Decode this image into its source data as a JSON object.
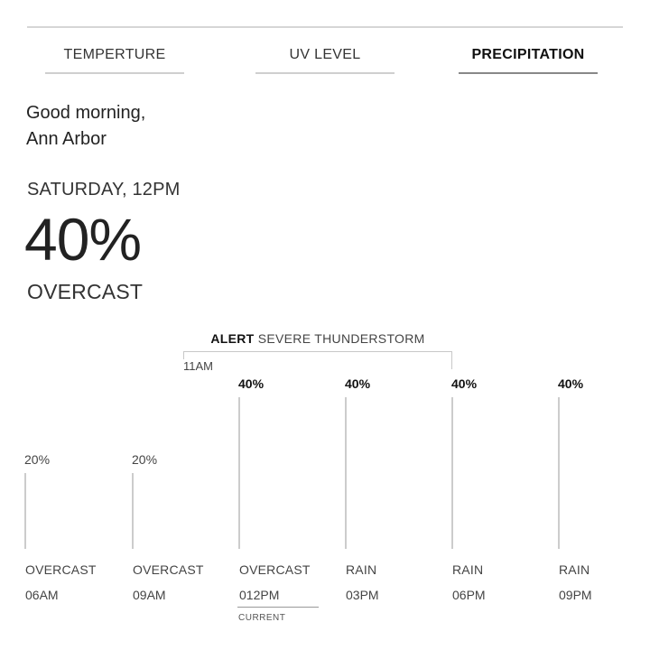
{
  "tabs": [
    {
      "label": "TEMPERTURE",
      "active": false
    },
    {
      "label": "UV LEVEL",
      "active": false
    },
    {
      "label": "PRECIPITATION",
      "active": true
    }
  ],
  "greeting": {
    "line1": "Good morning,",
    "line2": "Ann Arbor"
  },
  "current": {
    "day_time": "SATURDAY, 12PM",
    "value": "40%",
    "condition": "OVERCAST",
    "marker_label": "CURRENT"
  },
  "alert": {
    "label": "ALERT",
    "text": "SEVERE THUNDERSTORM",
    "start_time": "11AM"
  },
  "chart_data": {
    "type": "bar",
    "unit": "%",
    "categories": [
      "06AM",
      "09AM",
      "012PM",
      "03PM",
      "06PM",
      "09PM"
    ],
    "conditions": [
      "OVERCAST",
      "OVERCAST",
      "OVERCAST",
      "RAIN",
      "RAIN",
      "RAIN"
    ],
    "values": [
      20,
      20,
      40,
      40,
      40,
      40
    ],
    "value_labels": [
      "20%",
      "20%",
      "40%",
      "40%",
      "40%",
      "40%"
    ],
    "highlighted": [
      false,
      false,
      true,
      true,
      true,
      true
    ],
    "ylim": [
      0,
      40
    ]
  },
  "colors": {
    "text": "#222222",
    "bar_line": "#cccccc",
    "rule": "#d6d6d6"
  }
}
